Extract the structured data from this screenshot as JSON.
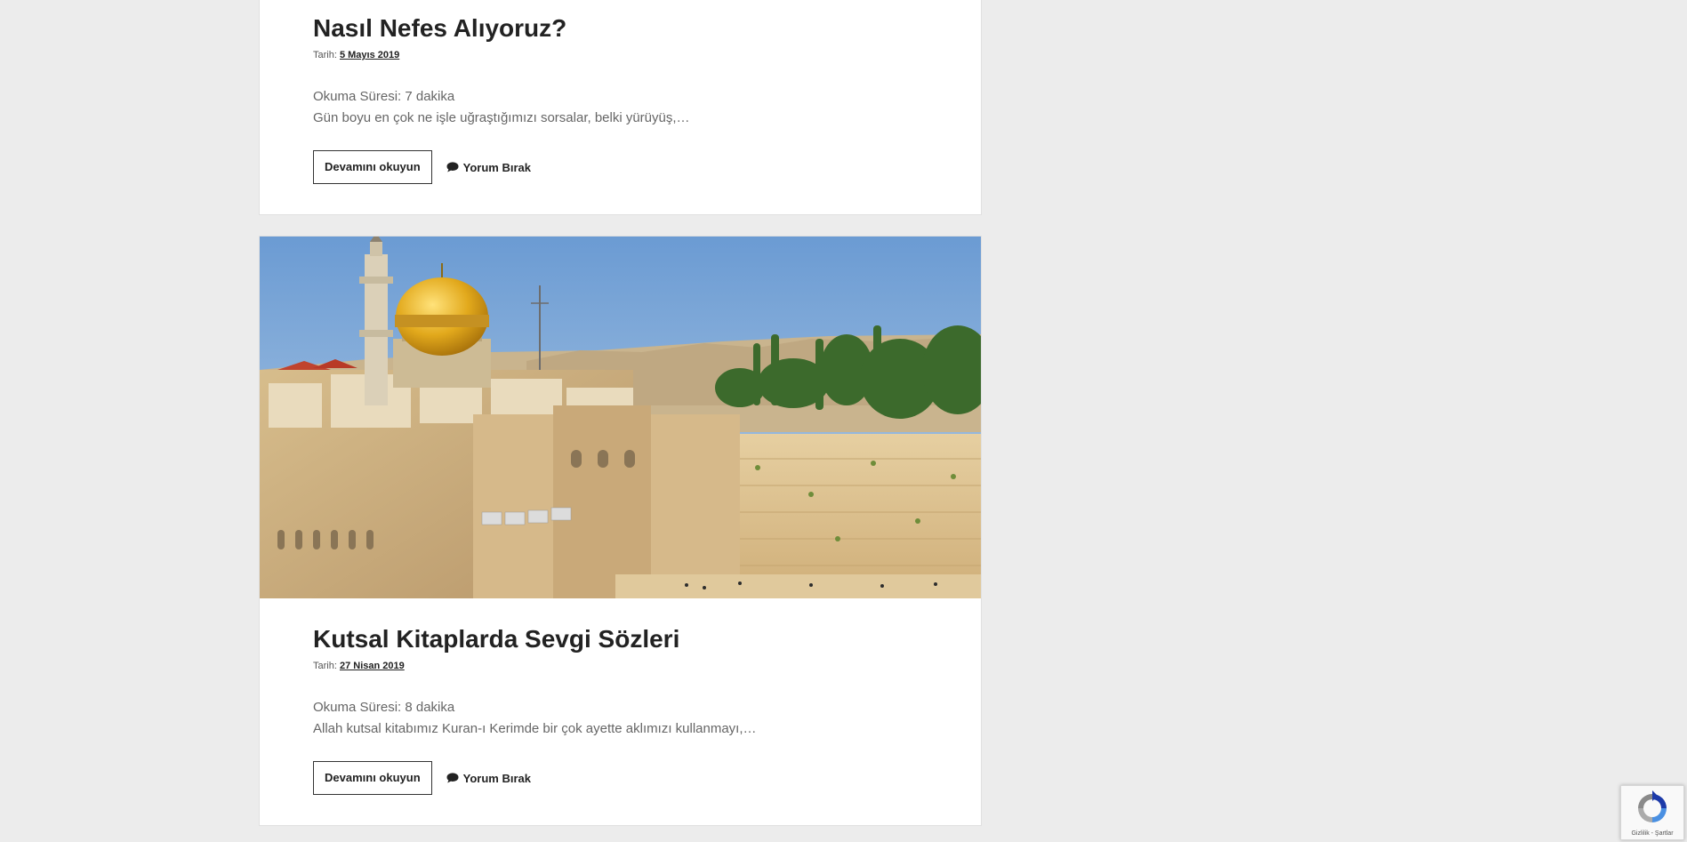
{
  "posts": [
    {
      "title": "Nasıl Nefes Alıyoruz?",
      "date_prefix": "Tarih:",
      "date": "5 Mayıs 2019",
      "reading_time": "Okuma Süresi: 7 dakika",
      "excerpt": "Gün boyu en çok ne işle uğraştığımızı sorsalar, belki yürüyüş,…",
      "read_more_label": "Devamını okuyun",
      "comment_label": "Yorum Bırak"
    },
    {
      "title": "Kutsal Kitaplarda Sevgi Sözleri",
      "date_prefix": "Tarih:",
      "date": "27 Nisan 2019",
      "reading_time": "Okuma Süresi: 8 dakika",
      "excerpt": "Allah kutsal kitabımız Kuran-ı Kerimde bir çok ayette aklımızı kullanmayı,…",
      "read_more_label": "Devamını okuyun",
      "comment_label": "Yorum Bırak"
    }
  ],
  "featured_image": {
    "icon": "featured-image-jerusalem"
  },
  "recaptcha": {
    "terms_text": "Gizlilik - Şartlar",
    "icon": "recaptcha-logo-icon"
  },
  "colors": {
    "page_background": "#ececec",
    "card_background": "#ffffff",
    "text_dark": "#222222",
    "text_muted": "#666666"
  }
}
